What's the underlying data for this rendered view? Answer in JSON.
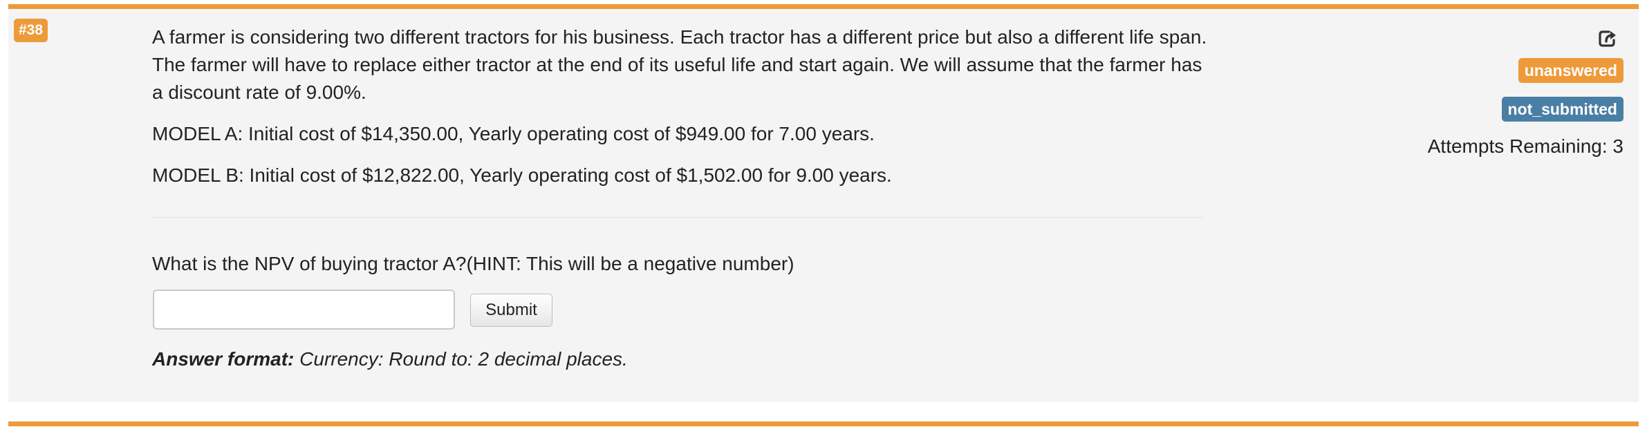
{
  "question": {
    "number_badge": "#38",
    "intro": "A farmer is considering two different tractors for his business. Each tractor has a different price but also a different life span. The farmer will have to replace either tractor at the end of its useful life and start again. We will assume that the farmer has a discount rate of 9.00%.",
    "model_a": "MODEL A: Initial cost of $14,350.00, Yearly operating cost of $949.00 for 7.00 years.",
    "model_b": "MODEL B: Initial cost of $12,822.00, Yearly operating cost of $1,502.00 for 9.00 years.",
    "prompt": "What is the NPV of buying tractor A?(HINT: This will be a negative number)",
    "answer_value": "",
    "submit_label": "Submit",
    "answer_format_label": "Answer format:",
    "answer_format_text": "Currency: Round to: 2 decimal places."
  },
  "status": {
    "refresh_icon": "share-refresh-icon",
    "answer_status": "unanswered",
    "submission_status": "not_submitted",
    "attempts_text": "Attempts Remaining: 3"
  },
  "colors": {
    "accent_orange": "#ee9a3a",
    "status_blue": "#4a7fa5",
    "panel_background": "#f4f4f4"
  }
}
